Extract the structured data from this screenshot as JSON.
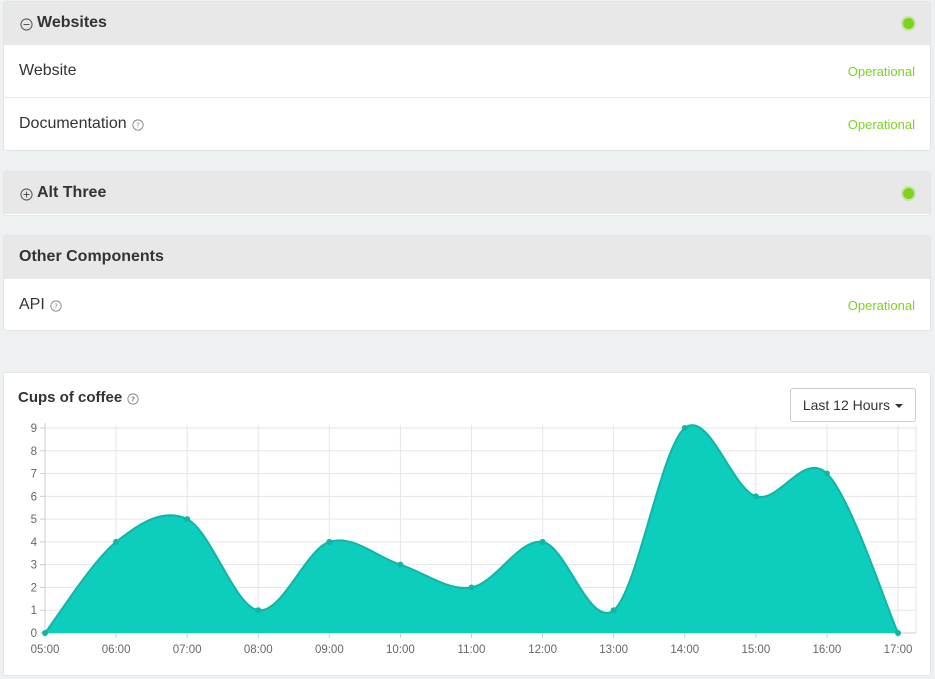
{
  "groups": [
    {
      "title": "Websites",
      "toggle": "collapse",
      "status_color": "#7ed321",
      "components": [
        {
          "name": "Website",
          "status": "Operational",
          "has_help": false
        },
        {
          "name": "Documentation",
          "status": "Operational",
          "has_help": true
        }
      ]
    },
    {
      "title": "Alt Three",
      "toggle": "expand",
      "status_color": "#7ed321",
      "components": []
    },
    {
      "title": "Other Components",
      "components": [
        {
          "name": "API",
          "status": "Operational",
          "has_help": true
        }
      ]
    }
  ],
  "metric": {
    "title": "Cups of coffee",
    "range_label": "Last 12 Hours"
  },
  "colors": {
    "operational": "#7ed321",
    "area_fill": "#0dcdbd",
    "area_stroke": "#10b5a6"
  },
  "icons": {
    "collapse": "minus-circle-icon",
    "expand": "plus-circle-icon",
    "help": "question-circle-icon",
    "dropdown": "caret-down-icon"
  },
  "chart_data": {
    "type": "area",
    "title": "Cups of coffee",
    "x": [
      "05:00",
      "06:00",
      "07:00",
      "08:00",
      "09:00",
      "10:00",
      "11:00",
      "12:00",
      "13:00",
      "14:00",
      "15:00",
      "16:00",
      "17:00"
    ],
    "y_ticks": [
      "0",
      "1",
      "2",
      "3",
      "4",
      "5",
      "6",
      "7",
      "8",
      "9"
    ],
    "series": [
      {
        "values": [
          0,
          4,
          5,
          1,
          4,
          3,
          2,
          4,
          1,
          9,
          6,
          7,
          0
        ]
      }
    ],
    "ylim": [
      0,
      9
    ],
    "grid": true
  }
}
